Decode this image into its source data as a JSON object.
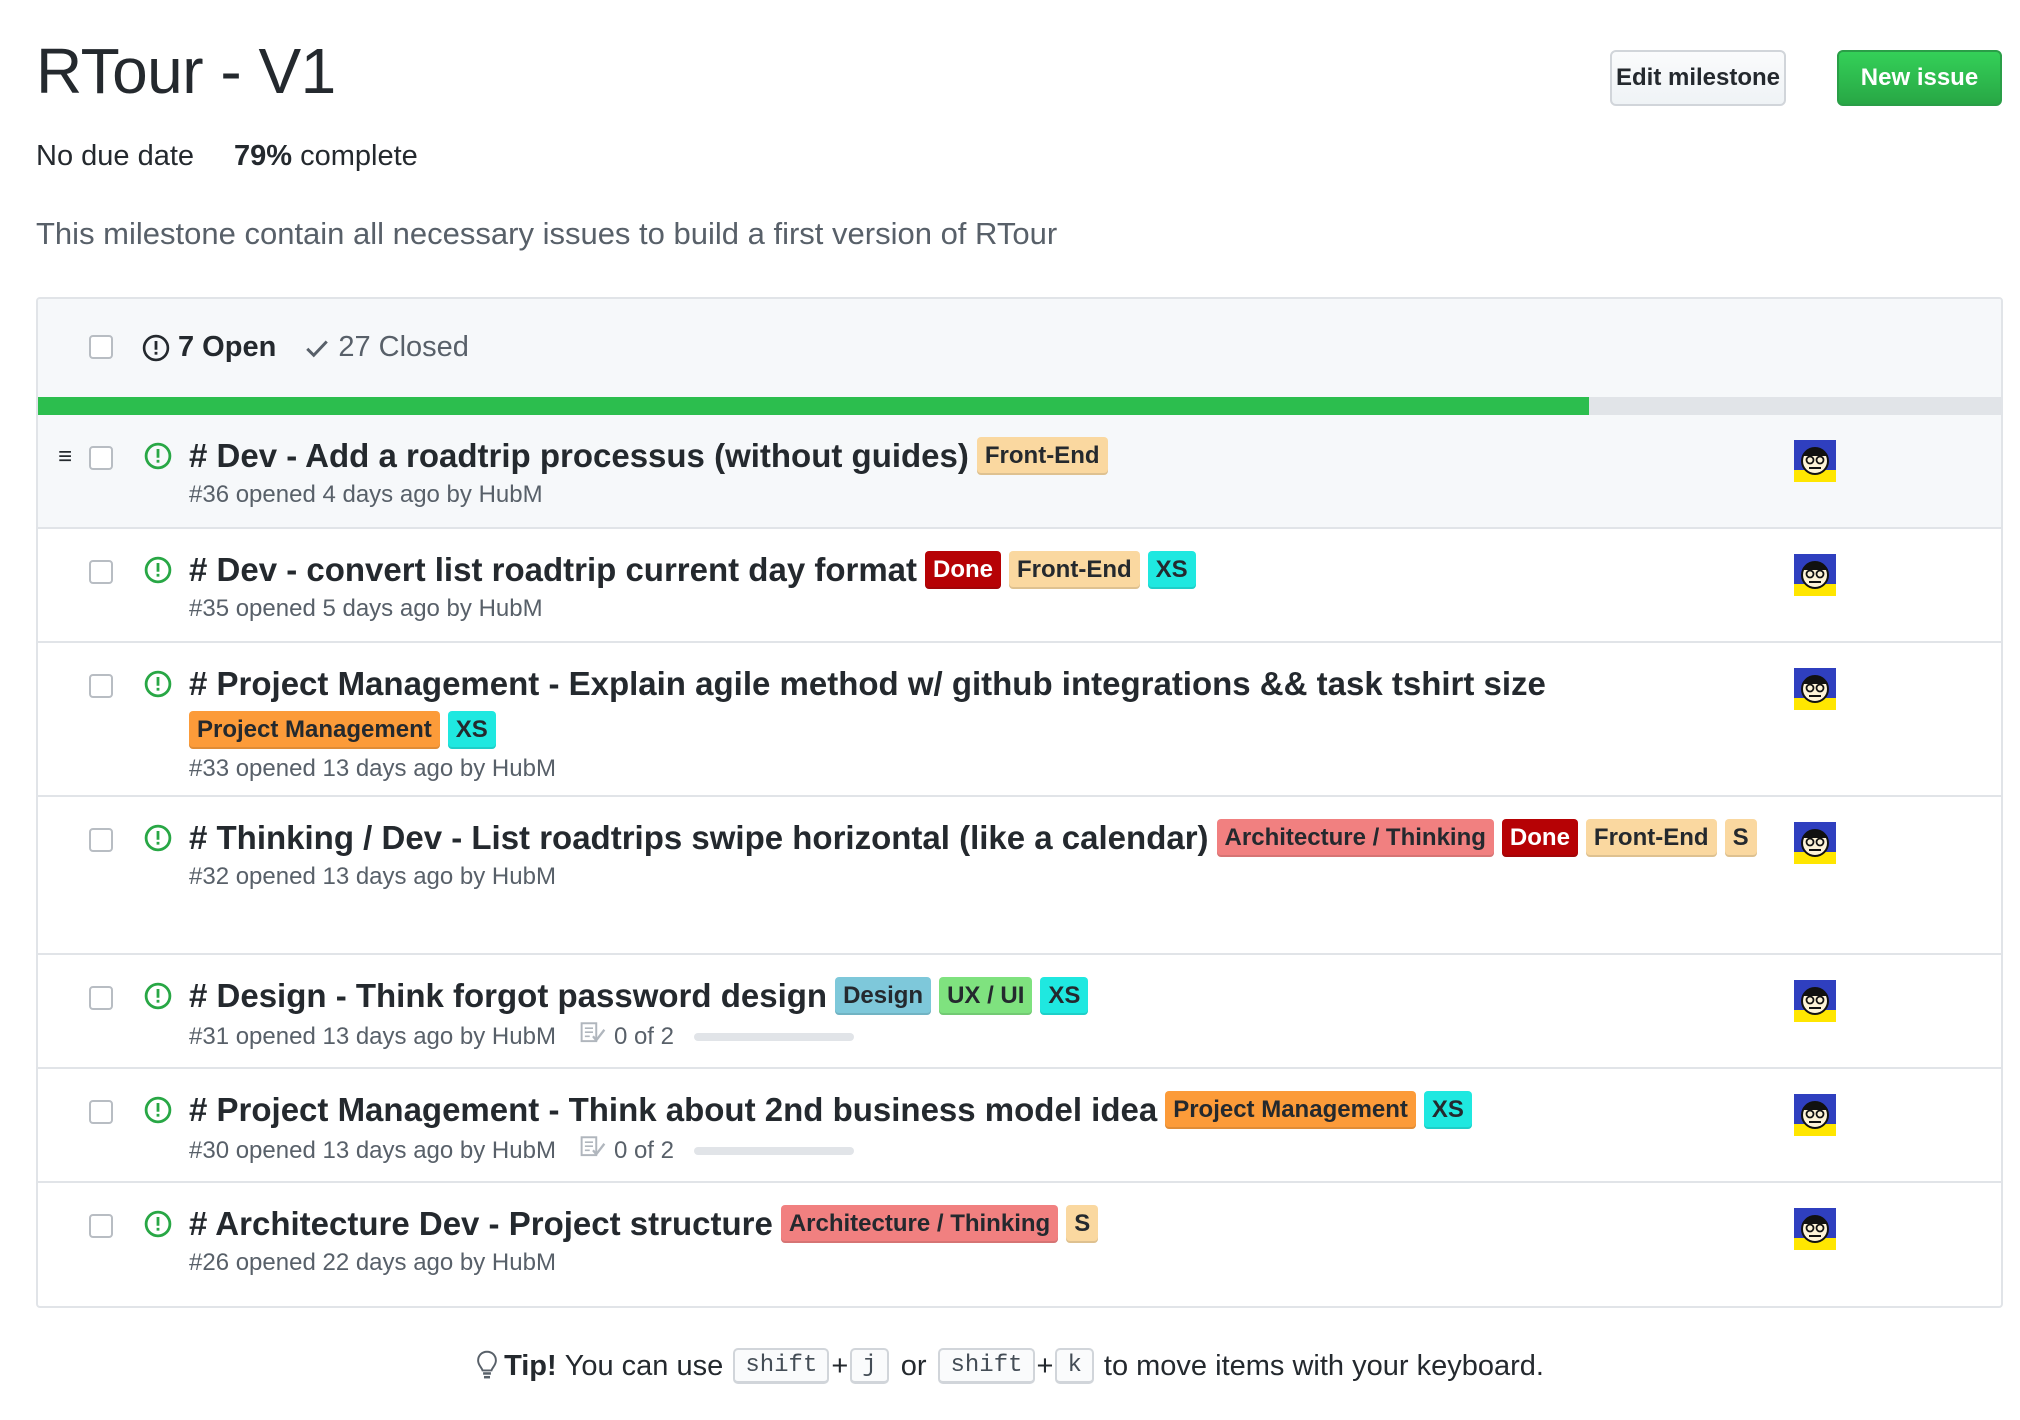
{
  "milestone": {
    "title": "RTour - V1",
    "due": "No due date",
    "percent": "79%",
    "complete_label": "complete",
    "description": "This milestone contain all necessary issues to build a first version of RTour",
    "progress_fraction": 0.79
  },
  "buttons": {
    "edit": "Edit milestone",
    "new": "New issue"
  },
  "states": {
    "open": "7 Open",
    "closed": "27 Closed"
  },
  "issues": [
    {
      "title": "# Dev - Add a roadtrip processus (without guides)",
      "labels": [
        {
          "text": "Front-End",
          "cls": "l-frontend"
        }
      ],
      "meta": "#36 opened 4 days ago by HubM"
    },
    {
      "title": "# Dev - convert list roadtrip current day format",
      "labels": [
        {
          "text": "Done",
          "cls": "l-done"
        },
        {
          "text": "Front-End",
          "cls": "l-frontend"
        },
        {
          "text": "XS",
          "cls": "l-xs"
        }
      ],
      "meta": "#35 opened 5 days ago by HubM"
    },
    {
      "title": "# Project Management - Explain agile method w/ github integrations && task tshirt size",
      "labels": [
        {
          "text": "Project Management",
          "cls": "l-pm"
        },
        {
          "text": "XS",
          "cls": "l-xs"
        }
      ],
      "meta": "#33 opened 13 days ago by HubM"
    },
    {
      "title": "# Thinking / Dev - List roadtrips swipe horizontal (like a calendar)",
      "labels": [
        {
          "text": "Architecture / Thinking",
          "cls": "l-arch"
        },
        {
          "text": "Done",
          "cls": "l-done"
        },
        {
          "text": "Front-End",
          "cls": "l-frontend"
        },
        {
          "text": "S",
          "cls": "l-s"
        }
      ],
      "meta": "#32 opened 13 days ago by HubM"
    },
    {
      "title": "# Design - Think forgot password design",
      "labels": [
        {
          "text": "Design",
          "cls": "l-design"
        },
        {
          "text": "UX / UI",
          "cls": "l-uxui"
        },
        {
          "text": "XS",
          "cls": "l-xs"
        }
      ],
      "meta": "#31 opened 13 days ago by HubM",
      "tasks": "0 of 2"
    },
    {
      "title": "# Project Management - Think about 2nd business model idea",
      "labels": [
        {
          "text": "Project Management",
          "cls": "l-pm"
        },
        {
          "text": "XS",
          "cls": "l-xs"
        }
      ],
      "meta": "#30 opened 13 days ago by HubM",
      "tasks": "0 of 2"
    },
    {
      "title": "# Architecture Dev - Project structure",
      "labels": [
        {
          "text": "Architecture / Thinking",
          "cls": "l-arch"
        },
        {
          "text": "S",
          "cls": "l-s"
        }
      ],
      "meta": "#26 opened 22 days ago by HubM"
    }
  ],
  "tip": {
    "bold": "Tip!",
    "pre": "You can use",
    "k1": "shift",
    "plus": "+",
    "k2": "j",
    "or": "or",
    "k3": "shift",
    "k4": "k",
    "post": "to move items with your keyboard."
  },
  "colors": {
    "green": "#2cbe4e",
    "open_icon": "#28a745",
    "done": "#b60205"
  }
}
